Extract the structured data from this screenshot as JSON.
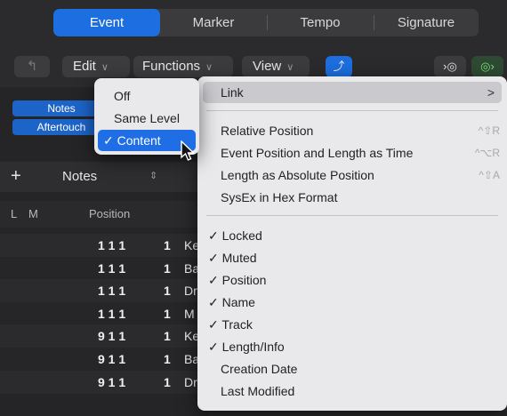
{
  "top_tabs": [
    "Event",
    "Marker",
    "Tempo",
    "Signature"
  ],
  "toolbar": {
    "back_icon": "up-arrow-icon",
    "edit": "Edit",
    "functions": "Functions",
    "view": "View",
    "accent": "#1d6ee0",
    "green": "#2f9c3a"
  },
  "left": {
    "tag_notes": "Notes",
    "tag_aftertouch": "Aftertouch",
    "add": "+",
    "notes_select": "Notes",
    "col_l": "L",
    "col_m": "M",
    "col_position": "Position"
  },
  "rows": [
    {
      "pos": "1 1 1",
      "len": "1",
      "name": "Ke"
    },
    {
      "pos": "1 1 1",
      "len": "1",
      "name": "Ba"
    },
    {
      "pos": "1 1 1",
      "len": "1",
      "name": "Dr"
    },
    {
      "pos": "1 1 1",
      "len": "1",
      "name": "M"
    },
    {
      "pos": "9 1 1",
      "len": "1",
      "name": "Ke"
    },
    {
      "pos": "9 1 1",
      "len": "1",
      "name": "Ba"
    },
    {
      "pos": "9 1 1",
      "len": "1",
      "name": "Dr"
    }
  ],
  "small_menu": {
    "off": "Off",
    "same": "Same Level",
    "content": "✓ Content"
  },
  "big_menu": {
    "link": "Link",
    "link_arrow": ">",
    "relative": "Relative Position",
    "relative_sc": "^⇧R",
    "event_time": "Event Position and Length as Time",
    "event_time_sc": "^⌥R",
    "length_abs": "Length as Absolute Position",
    "length_abs_sc": "^⇧A",
    "sysex": "SysEx in Hex Format",
    "locked": "✓ Locked",
    "muted": "✓ Muted",
    "position": "✓ Position",
    "name": "✓ Name",
    "track": "✓ Track",
    "length_info": "✓ Length/Info",
    "creation": "Creation Date",
    "last_mod": "Last Modified"
  }
}
